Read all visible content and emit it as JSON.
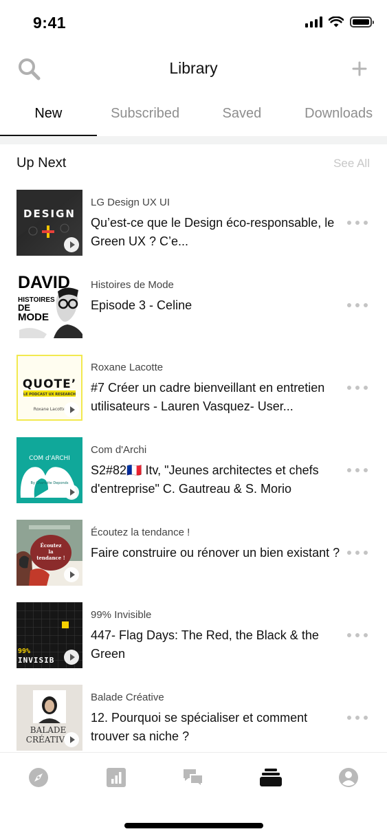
{
  "status_bar": {
    "time": "9:41"
  },
  "header": {
    "title": "Library"
  },
  "tabs": [
    {
      "label": "New",
      "active": true
    },
    {
      "label": "Subscribed",
      "active": false
    },
    {
      "label": "Saved",
      "active": false
    },
    {
      "label": "Downloads",
      "active": false
    }
  ],
  "section": {
    "title": "Up Next",
    "see_all": "See All"
  },
  "items": [
    {
      "show": "LG Design UX UI",
      "title": "Qu’est-ce que le Design éco-responsable, le Green UX ? C’e...",
      "thumb_text": "DESIGN"
    },
    {
      "show": "Histoires de Mode",
      "title": "Episode 3 - Celine",
      "thumb_text": "DAVID",
      "thumb_text_2": "HISTOIRES",
      "thumb_text_3": "DE",
      "thumb_text_4": "MODE"
    },
    {
      "show": "Roxane Lacotte",
      "title": "#7 Créer un cadre bienveillant en entretien utilisateurs - Lauren Vasquez- User...",
      "thumb_text": "QUOTE’",
      "thumb_text_2": "LE PODCAST UX RESEARCH",
      "thumb_text_3": "Roxane Lacotte"
    },
    {
      "show": "Com d'Archi",
      "title": "S2#82🇫🇷 Itv, \"Jeunes architectes et chefs d'entreprise\" C. Gautreau & S. Morio",
      "thumb_text": "COM d'ARCHI",
      "thumb_text_2": "By Charlotte Deponds"
    },
    {
      "show": "Écoutez la tendance !",
      "title": "Faire construire ou rénover un bien existant ?",
      "thumb_text": "Écoutez",
      "thumb_text_2": "la",
      "thumb_text_3": "tendance !"
    },
    {
      "show": "99% Invisible",
      "title": "447- Flag Days: The Red, the Black & the Green",
      "thumb_text": "99%",
      "thumb_text_2": "INVISIB"
    },
    {
      "show": "Balade Créative",
      "title": "12. Pourquoi se spécialiser et comment trouver sa niche ?",
      "thumb_text": "BALADE",
      "thumb_text_2": "CRÉATIV"
    }
  ],
  "colors": {
    "accent_yellow": "#f5c400",
    "teal": "#10a89a",
    "inactive_tab": "#8e8e8e",
    "see_all": "#c7c7c7"
  },
  "icons": {
    "header_left": "search-icon",
    "header_right": "plus-icon",
    "nav": [
      "compass-icon",
      "chart-icon",
      "chat-icon",
      "library-stack-icon",
      "profile-icon"
    ],
    "row_action": "more-dots-icon"
  }
}
